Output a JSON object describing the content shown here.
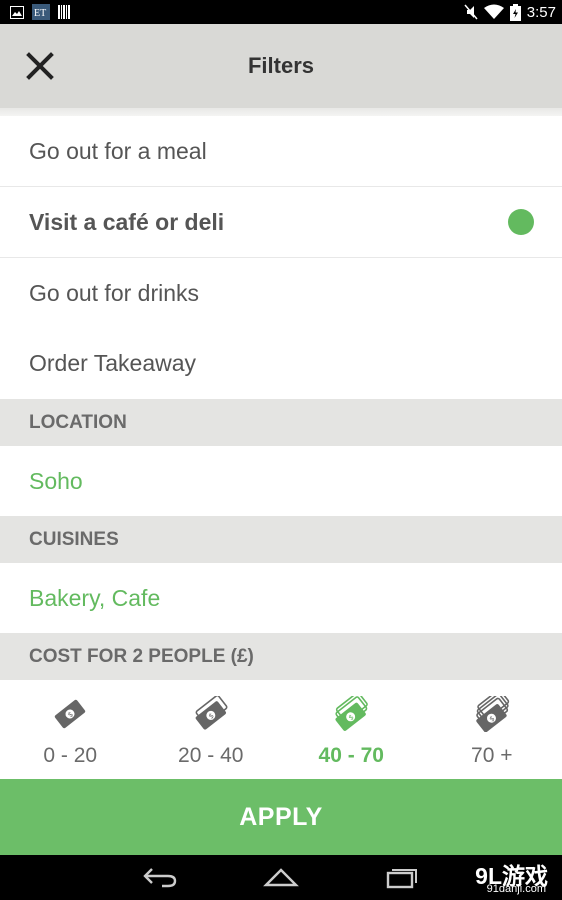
{
  "status_bar": {
    "time": "3:57",
    "icons": [
      "image-icon",
      "et-app-icon",
      "barcode-icon",
      "mute-icon",
      "wifi-icon",
      "battery-icon"
    ]
  },
  "header": {
    "title": "Filters",
    "close_icon": "close-icon"
  },
  "options": [
    {
      "label": "Go out for a meal",
      "selected": false
    },
    {
      "label": "Visit a café or deli",
      "selected": true
    },
    {
      "label": "Go out for drinks",
      "selected": false
    },
    {
      "label": "Order Takeaway",
      "selected": false
    }
  ],
  "location": {
    "heading": "LOCATION",
    "value": "Soho"
  },
  "cuisines": {
    "heading": "CUISINES",
    "value": "Bakery, Cafe"
  },
  "cost": {
    "heading": "COST FOR 2 PEOPLE (£)",
    "ranges": [
      {
        "label": "0 - 20",
        "selected": false,
        "notes": 1
      },
      {
        "label": "20 - 40",
        "selected": false,
        "notes": 2
      },
      {
        "label": "40 - 70",
        "selected": true,
        "notes": 3
      },
      {
        "label": "70 +",
        "selected": false,
        "notes": 4
      }
    ]
  },
  "apply_label": "APPLY",
  "watermark": {
    "main": "9L游戏",
    "sub": "91danji.com"
  },
  "colors": {
    "accent": "#63ba5f",
    "apply": "#6cbe68",
    "header": "#d9d9d6",
    "section": "#e4e4e2"
  }
}
